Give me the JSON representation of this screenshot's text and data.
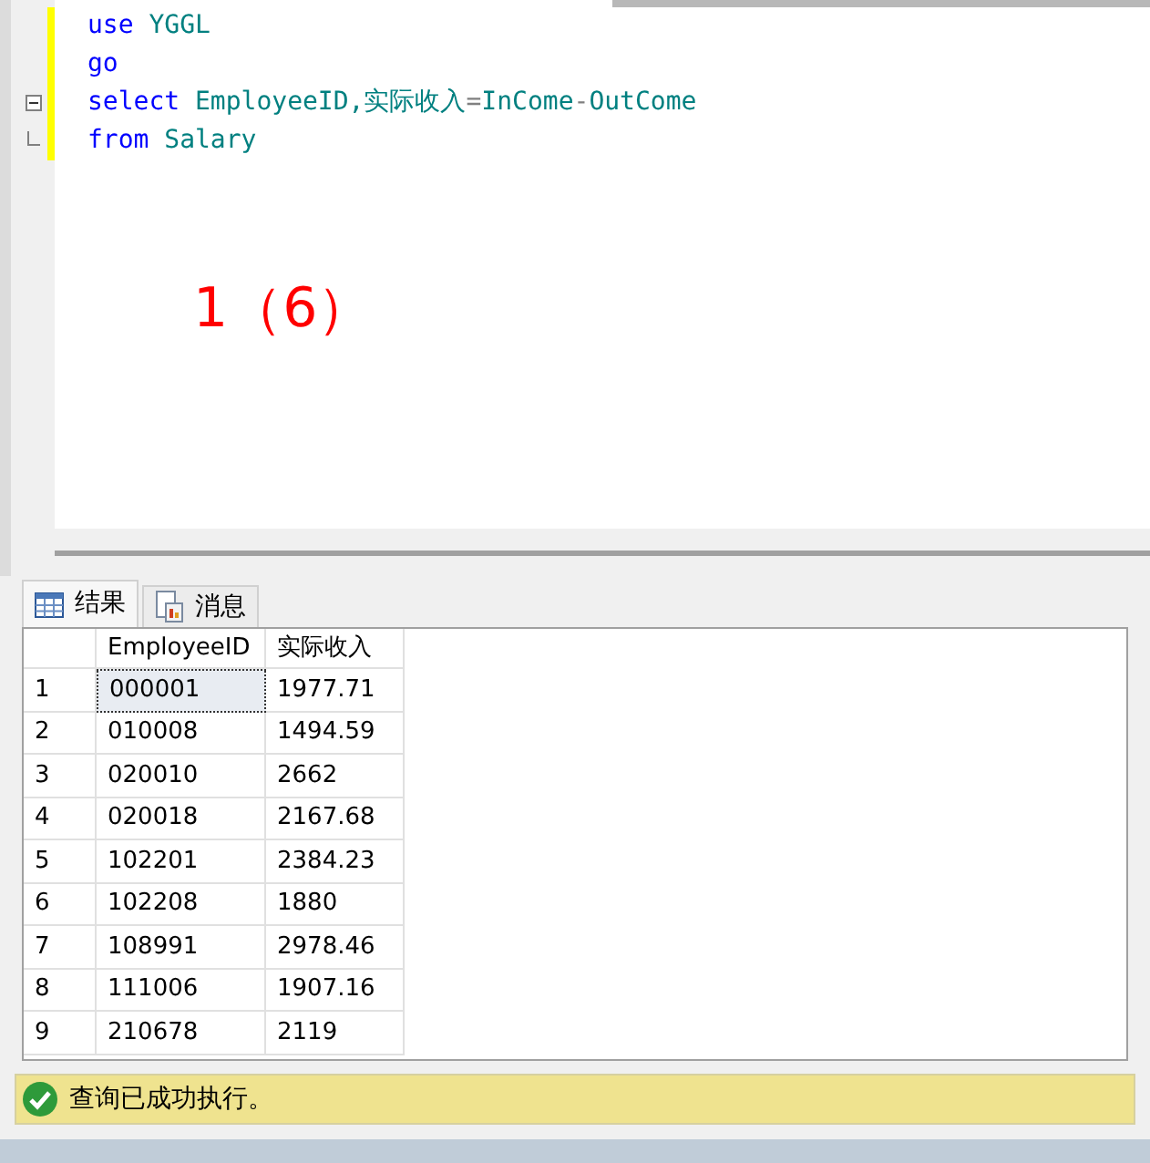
{
  "editor": {
    "lines": [
      {
        "kind": "plain",
        "tokens": [
          {
            "kind": "keyword",
            "text": "use"
          },
          {
            "kind": "ident",
            "text": " YGGL"
          }
        ]
      },
      {
        "kind": "plain",
        "tokens": [
          {
            "kind": "keyword",
            "text": "go"
          }
        ]
      },
      {
        "kind": "fold_start",
        "tokens": [
          {
            "kind": "keyword",
            "text": "select"
          },
          {
            "kind": "ident",
            "text": " EmployeeID,实际收入"
          },
          {
            "kind": "op",
            "text": "="
          },
          {
            "kind": "ident",
            "text": "InCome"
          },
          {
            "kind": "op",
            "text": "-"
          },
          {
            "kind": "ident",
            "text": "OutCome"
          }
        ]
      },
      {
        "kind": "fold_end",
        "tokens": [
          {
            "kind": "keyword",
            "text": "from"
          },
          {
            "kind": "ident",
            "text": " Salary"
          }
        ]
      }
    ],
    "annotation": "1（6）"
  },
  "tabs": [
    {
      "label": "结果",
      "kind": "grid",
      "selected": true
    },
    {
      "label": "消息",
      "kind": "document",
      "selected": false
    }
  ],
  "table": {
    "columns": [
      "EmployeeID",
      "实际收入"
    ],
    "rows": [
      {
        "index": "1",
        "cells": [
          "000001",
          "1977.71"
        ],
        "selected": true
      },
      {
        "index": "2",
        "cells": [
          "010008",
          "1494.59"
        ],
        "selected": false
      },
      {
        "index": "3",
        "cells": [
          "020010",
          "2662"
        ],
        "selected": false
      },
      {
        "index": "4",
        "cells": [
          "020018",
          "2167.68"
        ],
        "selected": false
      },
      {
        "index": "5",
        "cells": [
          "102201",
          "2384.23"
        ],
        "selected": false
      },
      {
        "index": "6",
        "cells": [
          "102208",
          "1880"
        ],
        "selected": false
      },
      {
        "index": "7",
        "cells": [
          "108991",
          "2978.46"
        ],
        "selected": false
      },
      {
        "index": "8",
        "cells": [
          "111006",
          "1907.16"
        ],
        "selected": false
      },
      {
        "index": "9",
        "cells": [
          "210678",
          "2119"
        ],
        "selected": false
      }
    ]
  },
  "status_bar": {
    "text": "查询已成功执行。"
  }
}
